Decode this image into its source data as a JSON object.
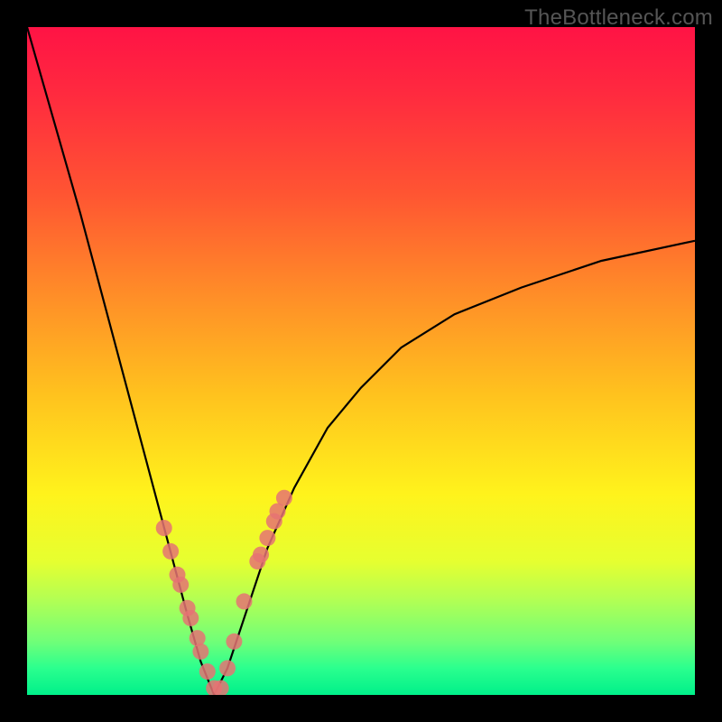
{
  "watermark": "TheBottleneck.com",
  "chart_data": {
    "type": "line",
    "title": "",
    "xlabel": "",
    "ylabel": "",
    "xlim": [
      0,
      1
    ],
    "ylim": [
      0,
      1
    ],
    "background": "rainbow-vertical (red→green)",
    "curve_description": "Sharp V-shaped dip: steep fall from top-left to a cusp ≈ x=0.28 at y≈0, then rises to the right, flattening asymptotically toward y≈0.68 at x=1",
    "series": [
      {
        "name": "bottleneck-curve",
        "x": [
          0.0,
          0.04,
          0.08,
          0.12,
          0.16,
          0.2,
          0.24,
          0.26,
          0.28,
          0.3,
          0.32,
          0.36,
          0.4,
          0.45,
          0.5,
          0.56,
          0.64,
          0.74,
          0.86,
          1.0
        ],
        "y": [
          1.0,
          0.86,
          0.72,
          0.57,
          0.42,
          0.27,
          0.12,
          0.05,
          0.0,
          0.04,
          0.1,
          0.22,
          0.31,
          0.4,
          0.46,
          0.52,
          0.57,
          0.61,
          0.65,
          0.68
        ]
      },
      {
        "name": "sample-dots",
        "x": [
          0.205,
          0.215,
          0.225,
          0.23,
          0.24,
          0.245,
          0.255,
          0.26,
          0.27,
          0.28,
          0.29,
          0.3,
          0.31,
          0.325,
          0.345,
          0.35,
          0.36,
          0.37,
          0.375,
          0.385
        ],
        "y": [
          0.25,
          0.215,
          0.18,
          0.165,
          0.13,
          0.115,
          0.085,
          0.065,
          0.035,
          0.01,
          0.01,
          0.04,
          0.08,
          0.14,
          0.2,
          0.21,
          0.235,
          0.26,
          0.275,
          0.295
        ]
      }
    ]
  }
}
